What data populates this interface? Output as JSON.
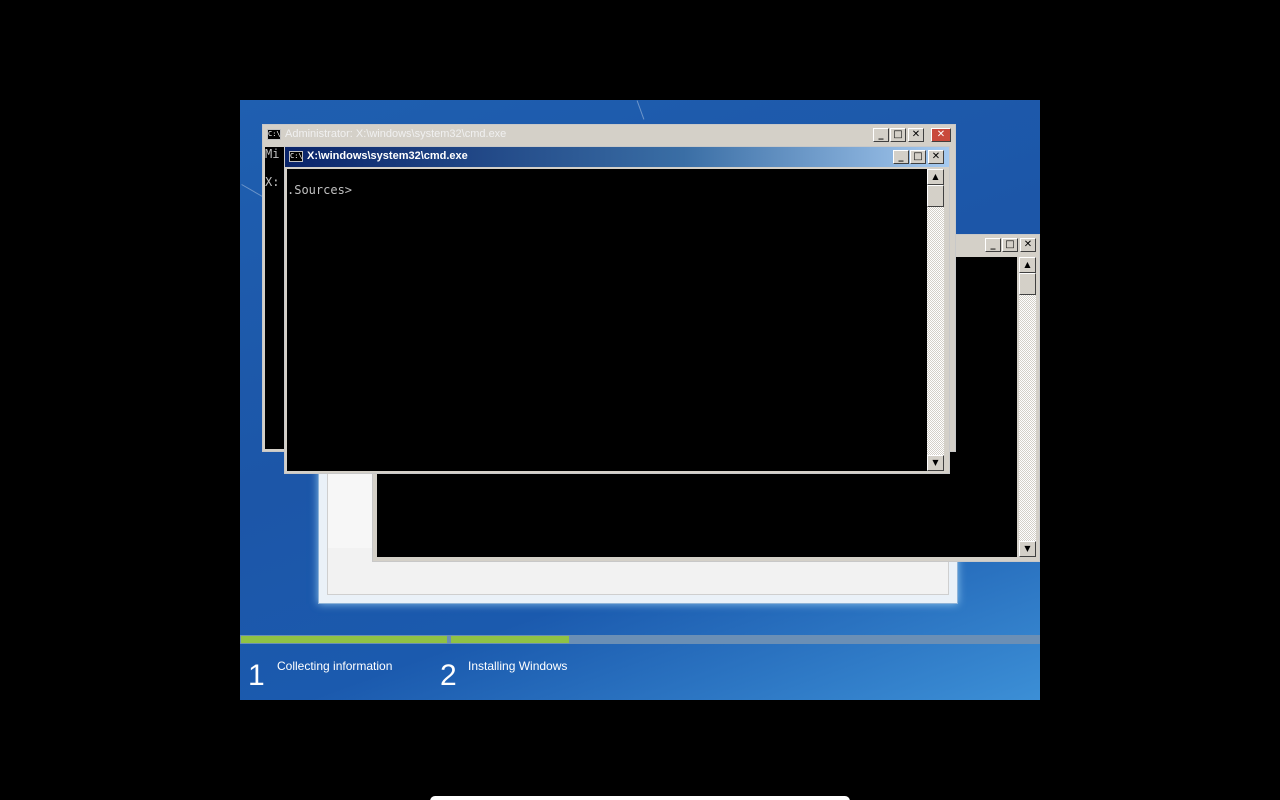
{
  "windows": {
    "admin_cmd": {
      "title": "Administrator: X:\\windows\\system32\\cmd.exe",
      "icon_label": "C:\\",
      "console_text": "Mi\n\nX:"
    },
    "front_cmd": {
      "title": "X:\\windows\\system32\\cmd.exe",
      "icon_label": "C:\\",
      "console_text": "\n.Sources>"
    },
    "buttons": {
      "minimize": "_",
      "maximize": "□",
      "close": "✕"
    },
    "scroll": {
      "up": "▲",
      "down": "▼"
    }
  },
  "setup": {
    "progress": {
      "step1_fill": 1.0,
      "step2_fill": 0.2
    },
    "steps": [
      {
        "number": "1",
        "label": "Collecting information"
      },
      {
        "number": "2",
        "label": "Installing Windows"
      }
    ]
  },
  "colors": {
    "desktop": "#1c56a8",
    "progress_fill": "#8fc245",
    "titlebar_active": "#0a246a"
  },
  "icons": [
    "cmd-icon",
    "minimize-icon",
    "maximize-icon",
    "close-icon",
    "mouse-cursor-icon"
  ]
}
